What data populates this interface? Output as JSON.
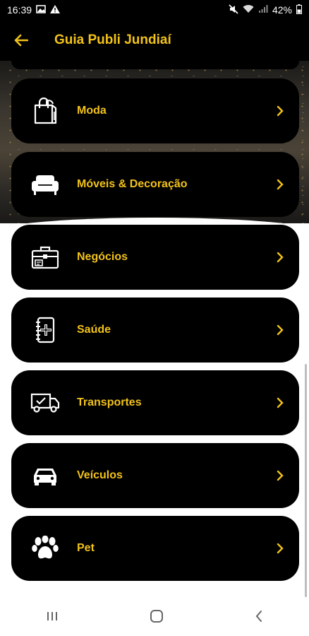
{
  "status_bar": {
    "time": "16:39",
    "battery": "42%"
  },
  "app_bar": {
    "title": "Guia Publi Jundiaí"
  },
  "categories": [
    {
      "label": "Moda",
      "icon": "shopping-bag-icon"
    },
    {
      "label": "Móveis & Decoração",
      "icon": "sofa-icon"
    },
    {
      "label": "Negócios",
      "icon": "briefcase-icon"
    },
    {
      "label": "Saúde",
      "icon": "health-notebook-icon"
    },
    {
      "label": "Transportes",
      "icon": "truck-icon"
    },
    {
      "label": "Veículos",
      "icon": "car-icon"
    },
    {
      "label": "Pet",
      "icon": "paw-icon"
    }
  ],
  "colors": {
    "accent": "#f2c21a",
    "card": "#000000",
    "background": "#ffffff"
  }
}
